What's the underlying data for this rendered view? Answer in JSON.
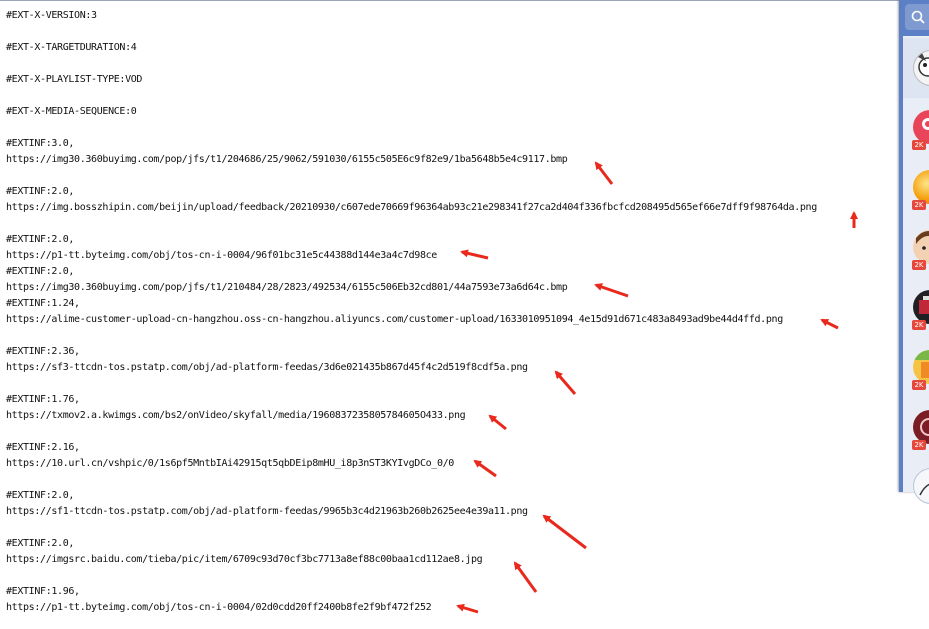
{
  "editor": {
    "lines": [
      "#EXT-X-VERSION:3",
      "",
      "#EXT-X-TARGETDURATION:4",
      "",
      "#EXT-X-PLAYLIST-TYPE:VOD",
      "",
      "#EXT-X-MEDIA-SEQUENCE:0",
      "",
      "#EXTINF:3.0,",
      "https://img30.360buyimg.com/pop/jfs/t1/204686/25/9062/591030/6155c505E6c9f82e9/1ba5648b5e4c9117.bmp",
      "",
      "#EXTINF:2.0,",
      "https://img.bosszhipin.com/beijin/upload/feedback/20210930/c607ede70669f96364ab93c21e298341f27ca2d404f336fbcfcd208495d565ef66e7dff9f98764da.png",
      "",
      "#EXTINF:2.0,",
      "https://p1-tt.byteimg.com/obj/tos-cn-i-0004/96f01bc31e5c44388d144e3a4c7d98ce",
      "#EXTINF:2.0,",
      "https://img30.360buyimg.com/pop/jfs/t1/210484/28/2823/492534/6155c506Eb32cd801/44a7593e73a6d64c.bmp",
      "#EXTINF:1.24,",
      "https://alime-customer-upload-cn-hangzhou.oss-cn-hangzhou.aliyuncs.com/customer-upload/1633010951094_4e15d91d671c483a8493ad9be44d4ffd.png",
      "",
      "#EXTINF:2.36,",
      "https://sf3-ttcdn-tos.pstatp.com/obj/ad-platform-feedas/3d6e021435b867d45f4c2d519f8cdf5a.png",
      "",
      "#EXTINF:1.76,",
      "https://txmov2.a.kwimgs.com/bs2/onVideo/skyfall/media/1960837235805784605O433.png",
      "",
      "#EXTINF:2.16,",
      "https://10.url.cn/vshpic/0/1s6pf5MntbIAi42915qt5qbDEip8mHU_i8p3nST3KYIvgDCo_0/0",
      "",
      "#EXTINF:2.0,",
      "https://sf1-ttcdn-tos.pstatp.com/obj/ad-platform-feedas/9965b3c4d21963b260b2625ee4e39a11.png",
      "",
      "#EXTINF:2.0,",
      "https://imgsrc.baidu.com/tieba/pic/item/6709c93d70cf3bc7713a8ef88c00baa1cd112ae8.jpg",
      "",
      "#EXTINF:1.96,",
      "https://p1-tt.byteimg.com/obj/tos-cn-i-0004/02d0cdd20ff2400b8fe2f9bf472f252"
    ]
  },
  "colors": {
    "arrow": "#e8291c",
    "sidebar": "#5b80c5",
    "badge": "#e6473c"
  },
  "sidebar": {
    "search_icon": "search-icon",
    "badges": [
      "2K",
      "2K",
      "2K",
      "2K",
      "2K",
      "2K"
    ]
  }
}
